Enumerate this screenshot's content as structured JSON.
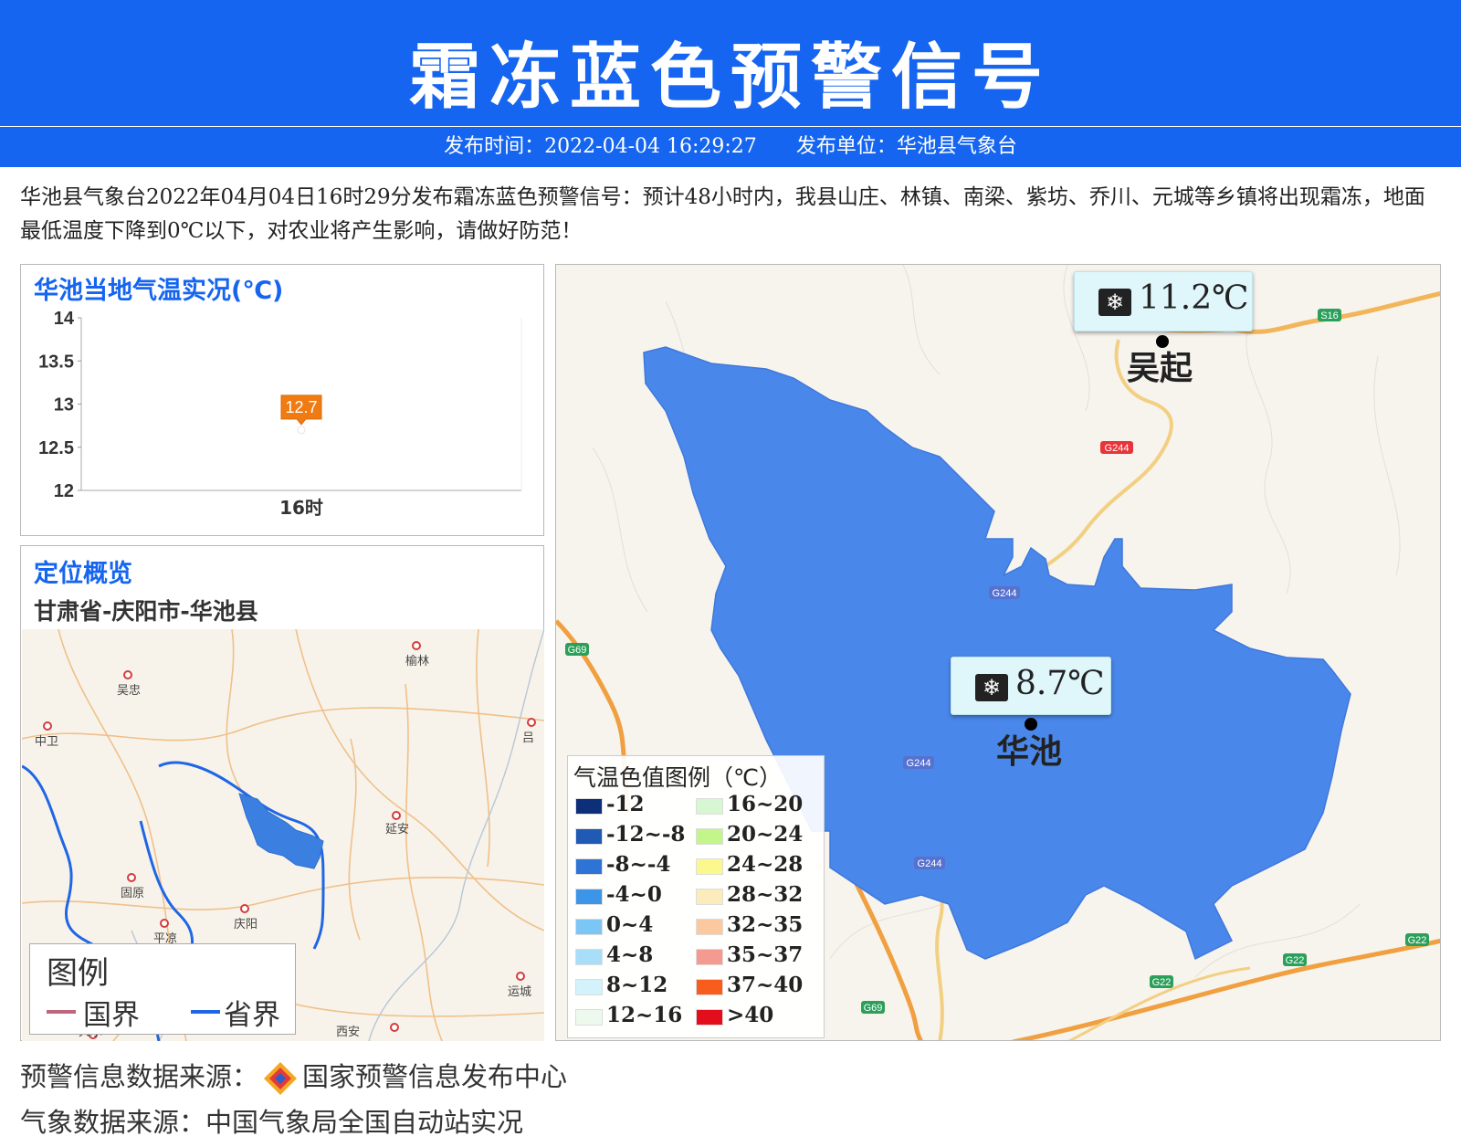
{
  "header": {
    "title": "霜冻蓝色预警信号",
    "publish_time": "发布时间：2022-04-04 16:29:27",
    "publisher": "发布单位：华池县气象台"
  },
  "warning": {
    "text": "华池县气象台2022年04月04日16时29分发布霜冻蓝色预警信号：预计48小时内，我县山庄、林镇、南梁、紫坊、乔川、元城等乡镇将出现霜冻，地面最低温度下降到0℃以下，对农业将产生影响，请做好防范！"
  },
  "temp_panel": {
    "title": "华池当地气温实况(℃)"
  },
  "chart_data": {
    "type": "line",
    "x": [
      "16时"
    ],
    "series": [
      {
        "values": [
          12.7
        ]
      }
    ],
    "data_labels": [
      "12.7"
    ],
    "ylim": [
      12,
      14
    ],
    "yticks": [
      "14",
      "13.5",
      "13",
      "12.5",
      "12"
    ],
    "yticks_values": [
      14,
      13.5,
      13,
      12.5,
      12
    ],
    "grid": false
  },
  "location_panel": {
    "title": "定位概览",
    "path": "甘肃省-庆阳市-华池县",
    "cities": [
      "榆林",
      "吴忠",
      "中卫",
      "吕",
      "延安",
      "固原",
      "庆阳",
      "平凉",
      "运城",
      "西安",
      "天水"
    ],
    "legend": {
      "title": "图例",
      "country_border": "国界",
      "province_border": "省界"
    },
    "colors": {
      "county_fill": "#3b7fe0",
      "province_line": "#1f66e6",
      "country_line": "#c0667a"
    }
  },
  "main_map": {
    "stations": [
      {
        "name": "吴起",
        "temp": "11.2℃"
      },
      {
        "name": "华池",
        "temp": "8.7℃"
      }
    ],
    "road_labels": [
      "S16",
      "G244",
      "G244",
      "G244",
      "G244",
      "G69",
      "G69",
      "G22",
      "G22",
      "G22"
    ],
    "county_fill": "#4a87ea",
    "legend": {
      "title": "气温色值图例（℃）",
      "items": [
        {
          "label": "-12",
          "color": "#0d2f7a"
        },
        {
          "label": "-12~-8",
          "color": "#1f5bb4"
        },
        {
          "label": "-8~-4",
          "color": "#2e74d6"
        },
        {
          "label": "-4~0",
          "color": "#3d95e8"
        },
        {
          "label": "0~4",
          "color": "#7cc6f6"
        },
        {
          "label": "4~8",
          "color": "#a8def8"
        },
        {
          "label": "8~12",
          "color": "#d3f2fb"
        },
        {
          "label": "12~16",
          "color": "#eef9ee"
        },
        {
          "label": "16~20",
          "color": "#d6f7d2"
        },
        {
          "label": "20~24",
          "color": "#c2f58a"
        },
        {
          "label": "24~28",
          "color": "#fbf98e"
        },
        {
          "label": "28~32",
          "color": "#fcecbb"
        },
        {
          "label": "32~35",
          "color": "#fbc9a0"
        },
        {
          "label": "35~37",
          "color": "#f59a90"
        },
        {
          "label": "37~40",
          "color": "#f95d1e"
        },
        {
          "label": ">40",
          "color": "#e20e1b"
        }
      ]
    }
  },
  "footer": {
    "warning_source": "预警信息数据来源：",
    "warning_source_name": "国家预警信息发布中心",
    "weather_source": "气象数据来源：中国气象局全国自动站实况"
  }
}
